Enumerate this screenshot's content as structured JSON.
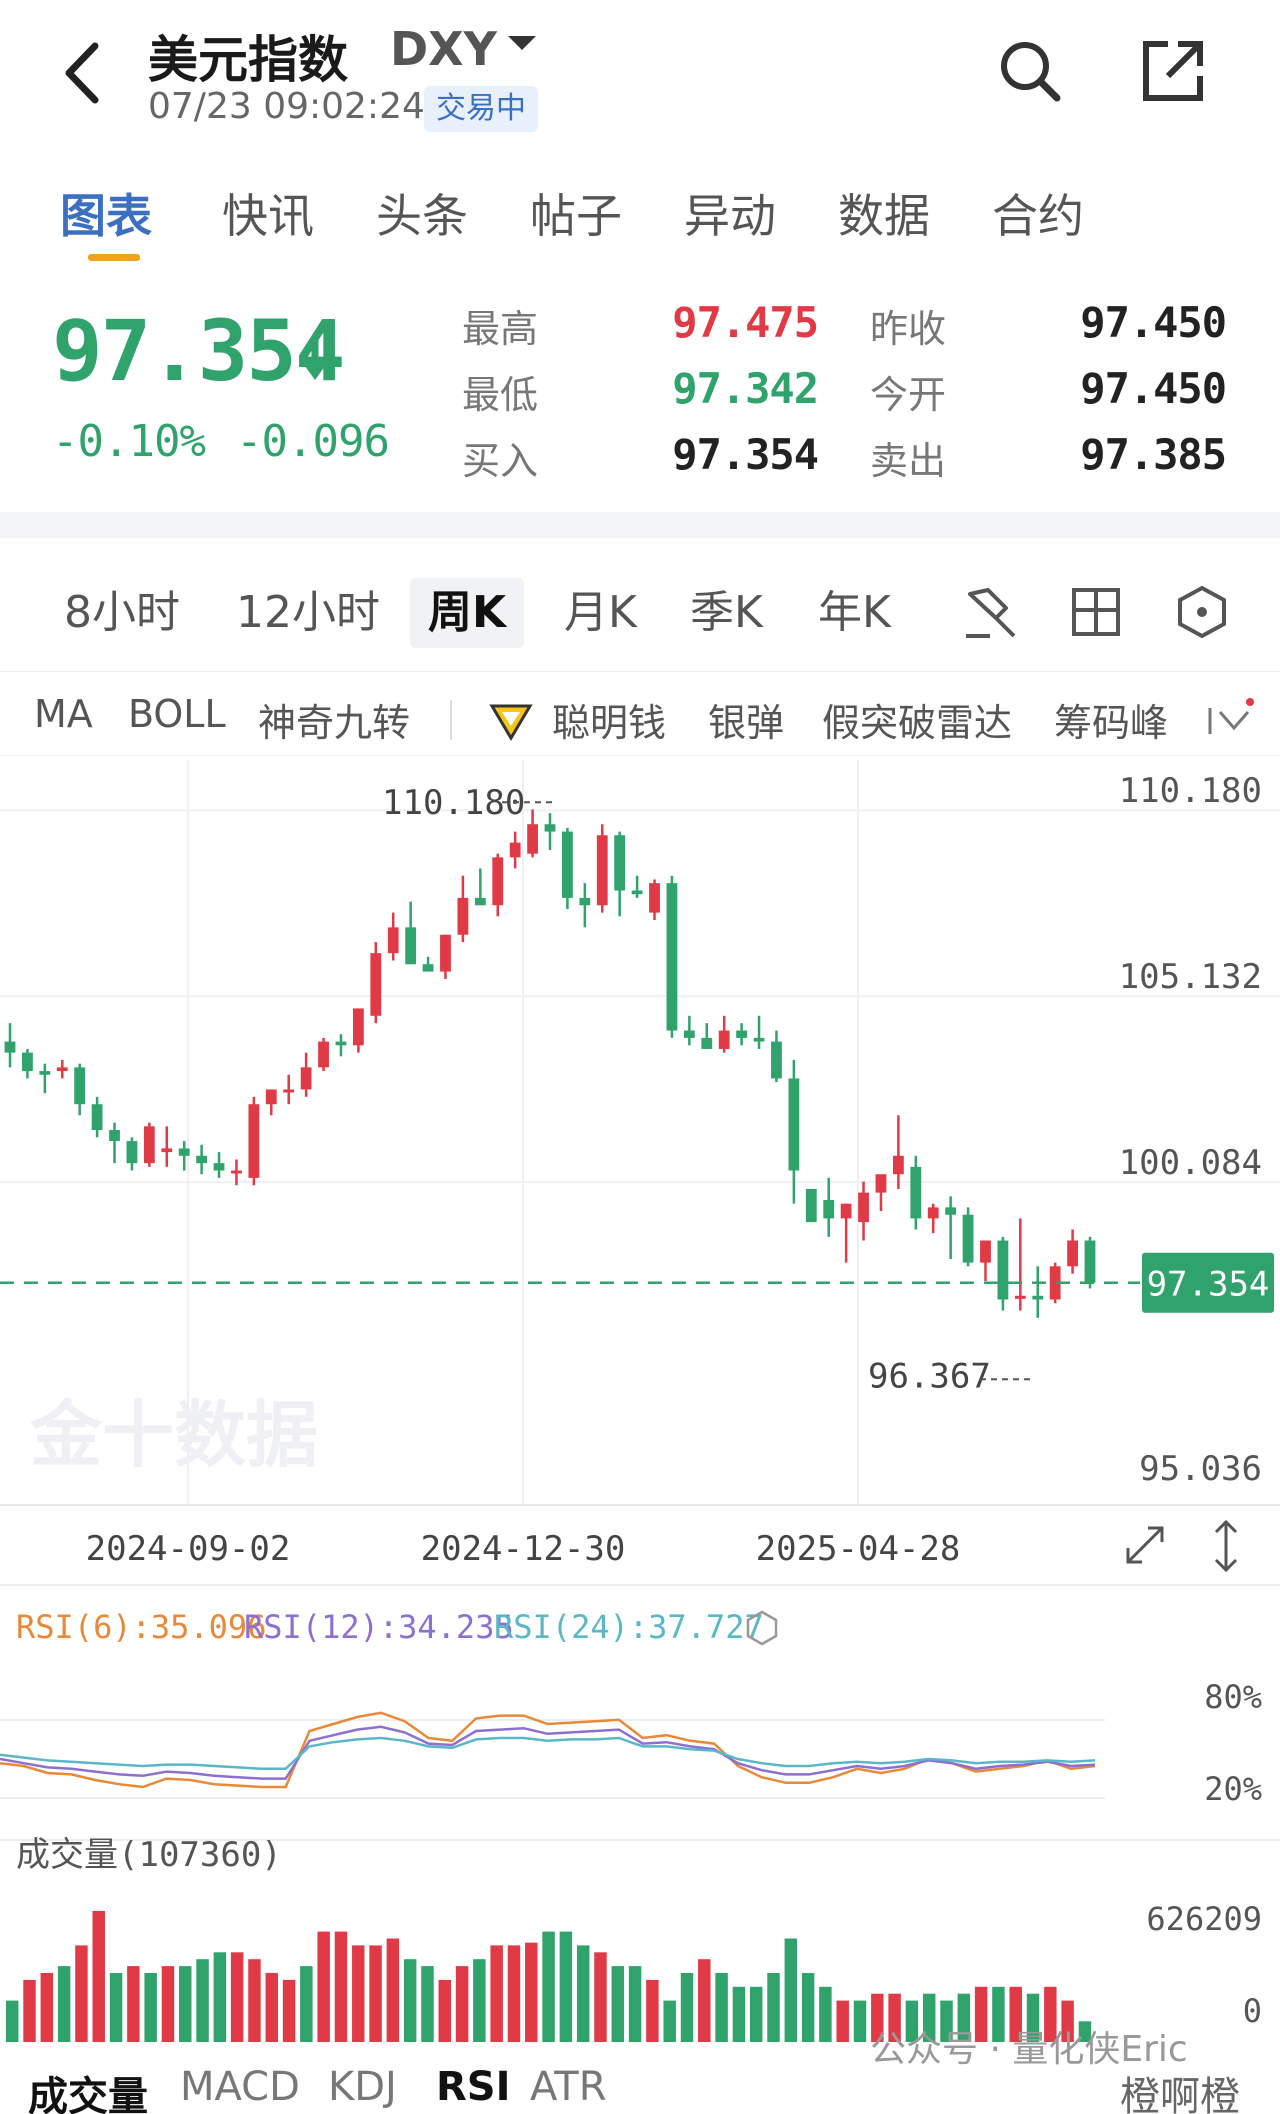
{
  "header": {
    "title": "美元指数",
    "symbol": "DXY",
    "timestamp": "07/23 09:02:24",
    "status": "交易中"
  },
  "tabs": [
    "图表",
    "快讯",
    "头条",
    "帖子",
    "异动",
    "数据",
    "合约"
  ],
  "quote": {
    "price": "97.354",
    "change_pct": "-0.10%",
    "change_abs": "-0.096",
    "rows": [
      {
        "l1": "最高",
        "v1": "97.475",
        "l2": "昨收",
        "v2": "97.450"
      },
      {
        "l1": "最低",
        "v1": "97.342",
        "l2": "今开",
        "v2": "97.450"
      },
      {
        "l1": "买入",
        "v1": "97.354",
        "l2": "卖出",
        "v2": "97.385"
      }
    ]
  },
  "colors": {
    "up": "#e03a47",
    "down": "#2fa36b",
    "accent": "#3b6fc1",
    "highlight": "#f0a21a"
  },
  "periods": [
    "8小时",
    "12小时",
    "周K",
    "月K",
    "季K",
    "年K"
  ],
  "period_active": "周K",
  "indicators": [
    "MA",
    "BOLL",
    "神奇九转",
    "聪明钱",
    "银弹",
    "假突破雷达",
    "筹码峰"
  ],
  "chart_data": {
    "type": "candlestick",
    "y_ticks": [
      "110.180",
      "105.132",
      "100.084",
      "95.036"
    ],
    "y_tick_values": [
      110.18,
      105.132,
      100.084,
      95.036
    ],
    "x_labels": [
      "2024-09-02",
      "2024-12-30",
      "2025-04-28"
    ],
    "high_label": "110.180",
    "low_label": "96.367",
    "current_price": "97.354",
    "current_value": 97.354,
    "watermark": "金十数据",
    "candles": [
      [
        103.9,
        104.4,
        103.2,
        103.6
      ],
      [
        103.6,
        103.7,
        102.9,
        103.1
      ],
      [
        103.1,
        103.3,
        102.5,
        103.0
      ],
      [
        103.1,
        103.4,
        102.9,
        103.2
      ],
      [
        103.2,
        103.3,
        101.9,
        102.2
      ],
      [
        102.2,
        102.4,
        101.3,
        101.5
      ],
      [
        101.5,
        101.7,
        100.6,
        101.2
      ],
      [
        101.2,
        101.3,
        100.4,
        100.6
      ],
      [
        100.6,
        101.7,
        100.5,
        101.6
      ],
      [
        100.9,
        101.6,
        100.5,
        101.0
      ],
      [
        101.0,
        101.2,
        100.4,
        100.8
      ],
      [
        100.8,
        101.1,
        100.3,
        100.6
      ],
      [
        100.6,
        100.9,
        100.2,
        100.4
      ],
      [
        100.4,
        100.7,
        100.0,
        100.4
      ],
      [
        100.2,
        102.4,
        100.0,
        102.2
      ],
      [
        102.2,
        102.6,
        101.9,
        102.6
      ],
      [
        102.6,
        103.0,
        102.2,
        102.6
      ],
      [
        102.6,
        103.6,
        102.4,
        103.2
      ],
      [
        103.2,
        104.0,
        103.1,
        103.9
      ],
      [
        103.9,
        104.1,
        103.5,
        103.8
      ],
      [
        103.8,
        104.8,
        103.6,
        104.8
      ],
      [
        104.6,
        106.6,
        104.4,
        106.3
      ],
      [
        106.3,
        107.4,
        106.1,
        107.0
      ],
      [
        107.0,
        107.7,
        106.0,
        106.0
      ],
      [
        106.0,
        106.2,
        105.8,
        105.8
      ],
      [
        105.8,
        106.8,
        105.6,
        106.8
      ],
      [
        106.8,
        108.4,
        106.6,
        107.8
      ],
      [
        107.8,
        108.6,
        107.6,
        107.6
      ],
      [
        107.6,
        109.0,
        107.3,
        108.9
      ],
      [
        108.9,
        109.6,
        108.6,
        109.3
      ],
      [
        109.0,
        110.2,
        108.9,
        109.8
      ],
      [
        109.8,
        110.1,
        109.1,
        109.6
      ],
      [
        109.6,
        109.7,
        107.5,
        107.8
      ],
      [
        107.8,
        108.2,
        107.0,
        107.6
      ],
      [
        107.6,
        109.8,
        107.4,
        109.5
      ],
      [
        109.5,
        109.6,
        107.3,
        108.0
      ],
      [
        108.0,
        108.4,
        107.8,
        107.9
      ],
      [
        107.4,
        108.3,
        107.2,
        108.2
      ],
      [
        108.2,
        108.4,
        104.0,
        104.2
      ],
      [
        104.2,
        104.6,
        103.8,
        104.0
      ],
      [
        104.0,
        104.4,
        103.8,
        103.7
      ],
      [
        103.7,
        104.6,
        103.6,
        104.2
      ],
      [
        104.2,
        104.4,
        103.8,
        104.0
      ],
      [
        104.0,
        104.6,
        103.7,
        103.9
      ],
      [
        103.9,
        104.2,
        102.8,
        102.9
      ],
      [
        102.9,
        103.4,
        99.5,
        100.4
      ],
      [
        99.9,
        99.8,
        99.0,
        99.0
      ],
      [
        99.6,
        100.2,
        98.6,
        99.1
      ],
      [
        99.1,
        99.5,
        97.9,
        99.5
      ],
      [
        99.0,
        100.1,
        98.5,
        99.8
      ],
      [
        99.8,
        100.2,
        99.3,
        100.3
      ],
      [
        100.3,
        101.9,
        99.9,
        100.8
      ],
      [
        100.5,
        100.8,
        98.8,
        99.1
      ],
      [
        99.1,
        99.5,
        98.7,
        99.4
      ],
      [
        99.4,
        99.7,
        98.0,
        99.2
      ],
      [
        99.2,
        99.4,
        97.8,
        97.9
      ],
      [
        97.9,
        98.5,
        97.4,
        98.5
      ],
      [
        98.5,
        98.6,
        96.6,
        96.9
      ],
      [
        97.0,
        99.1,
        96.6,
        97.0
      ],
      [
        97.0,
        97.8,
        96.4,
        96.9
      ],
      [
        96.9,
        97.9,
        96.8,
        97.8
      ],
      [
        97.8,
        98.8,
        97.6,
        98.5
      ],
      [
        98.5,
        98.6,
        97.2,
        97.354
      ]
    ],
    "rsi": {
      "labels": [
        "RSI(6):35.096",
        "RSI(12):34.235",
        "RSI(24):37.727"
      ],
      "colors": [
        "#e8893a",
        "#8d6fd0",
        "#5bb7c8"
      ],
      "ticks": [
        "80%",
        "20%"
      ],
      "rsi6": [
        42,
        40,
        35,
        34,
        30,
        27,
        25,
        31,
        30,
        27,
        26,
        25,
        25,
        65,
        70,
        75,
        78,
        72,
        60,
        58,
        74,
        76,
        76,
        70,
        71,
        72,
        73,
        60,
        62,
        58,
        56,
        40,
        32,
        28,
        28,
        32,
        38,
        35,
        38,
        45,
        42,
        36,
        38,
        40,
        44,
        38,
        40
      ],
      "rsi12": [
        45,
        42,
        39,
        38,
        36,
        34,
        33,
        36,
        35,
        33,
        32,
        31,
        31,
        58,
        62,
        66,
        68,
        64,
        56,
        55,
        65,
        66,
        67,
        63,
        64,
        65,
        66,
        56,
        57,
        54,
        52,
        42,
        37,
        34,
        34,
        37,
        40,
        38,
        40,
        44,
        42,
        38,
        40,
        41,
        43,
        40,
        41
      ],
      "rsi24": [
        48,
        46,
        44,
        43,
        42,
        41,
        40,
        41,
        41,
        40,
        39,
        38,
        38,
        54,
        57,
        59,
        60,
        58,
        54,
        53,
        59,
        60,
        60,
        58,
        59,
        59,
        60,
        54,
        54,
        52,
        51,
        45,
        42,
        40,
        40,
        42,
        43,
        42,
        43,
        45,
        44,
        42,
        43,
        43,
        44,
        43,
        44
      ]
    },
    "volume": {
      "label": "成交量(107360)",
      "max_label": "626209",
      "zero_label": "0",
      "bars": [
        0.3,
        0.45,
        0.5,
        0.55,
        0.7,
        0.95,
        0.5,
        0.55,
        0.5,
        0.55,
        0.55,
        0.6,
        0.65,
        0.65,
        0.6,
        0.5,
        0.45,
        0.55,
        0.8,
        0.8,
        0.7,
        0.7,
        0.75,
        0.6,
        0.55,
        0.45,
        0.55,
        0.6,
        0.7,
        0.7,
        0.72,
        0.8,
        0.8,
        0.7,
        0.65,
        0.55,
        0.55,
        0.45,
        0.3,
        0.5,
        0.6,
        0.5,
        0.4,
        0.4,
        0.5,
        0.75,
        0.5,
        0.4,
        0.3,
        0.3,
        0.35,
        0.35,
        0.3,
        0.35,
        0.3,
        0.35,
        0.4,
        0.4,
        0.4,
        0.35,
        0.4,
        0.3,
        0.15
      ],
      "up": [
        0,
        1,
        1,
        0,
        1,
        1,
        0,
        1,
        0,
        1,
        0,
        0,
        0,
        1,
        1,
        1,
        1,
        0,
        1,
        1,
        1,
        1,
        1,
        0,
        0,
        1,
        1,
        0,
        1,
        1,
        1,
        0,
        0,
        0,
        1,
        0,
        0,
        1,
        0,
        0,
        1,
        0,
        0,
        0,
        0,
        0,
        0,
        0,
        1,
        0,
        1,
        1,
        0,
        0,
        0,
        0,
        1,
        0,
        1,
        0,
        1,
        1,
        0
      ]
    }
  },
  "bottom_tabs": [
    "成交量",
    "MACD",
    "KDJ",
    "RSI",
    "ATR"
  ],
  "bottom_active": "RSI",
  "footer": {
    "wechat": "公众号 · 量化侠Eric",
    "account": "橙啊橙"
  }
}
